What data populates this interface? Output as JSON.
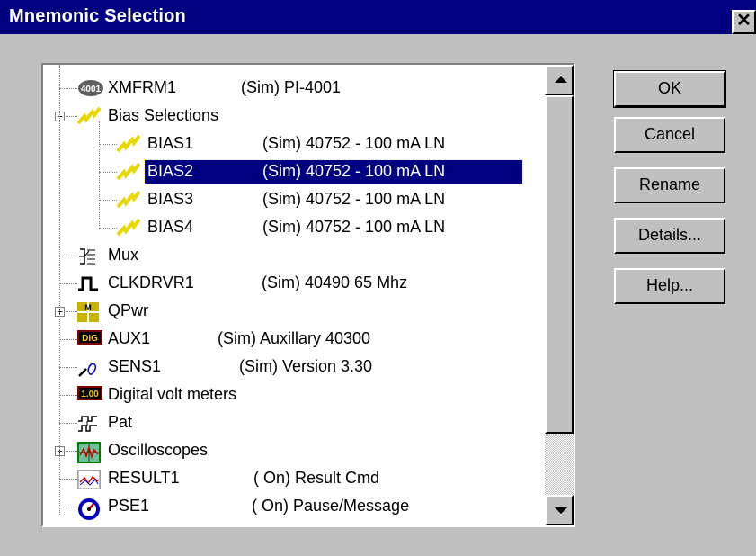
{
  "window": {
    "title": "Mnemonic Selection",
    "close_glyph": "✕"
  },
  "tree": {
    "items": [
      {
        "name": "XMFRM1",
        "desc": "(Sim) PI-4001",
        "icon": "chip-4001-icon",
        "icon_text": "4001",
        "level": 0
      },
      {
        "name": "Bias Selections",
        "desc": "",
        "icon": "lightning-icon",
        "level": 0,
        "expander": "−"
      },
      {
        "name": "BIAS1",
        "desc": "(Sim) 40752 - 100 mA LN",
        "icon": "lightning-icon",
        "level": 1
      },
      {
        "name": "BIAS2",
        "desc": "(Sim) 40752 - 100 mA LN",
        "icon": "lightning-icon",
        "level": 1,
        "selected": true
      },
      {
        "name": "BIAS3",
        "desc": "(Sim) 40752 - 100 mA LN",
        "icon": "lightning-icon",
        "level": 1
      },
      {
        "name": "BIAS4",
        "desc": "(Sim) 40752 - 100 mA LN",
        "icon": "lightning-icon",
        "level": 1
      },
      {
        "name": "Mux",
        "desc": "",
        "icon": "mux-icon",
        "level": 0
      },
      {
        "name": "CLKDRVR1",
        "desc": "(Sim) 40490 65 Mhz",
        "icon": "clock-pulse-icon",
        "level": 0
      },
      {
        "name": "QPwr",
        "desc": "",
        "icon": "qpwr-icon",
        "level": 0,
        "expander": "+"
      },
      {
        "name": "AUX1",
        "desc": "(Sim) Auxillary 40300",
        "icon": "dig-icon",
        "icon_text": "DIG",
        "level": 0
      },
      {
        "name": "SENS1",
        "desc": "(Sim) Version 3.30",
        "icon": "sensor-curve-icon",
        "level": 0
      },
      {
        "name": "Digital volt meters",
        "desc": "",
        "icon": "voltmeter-icon",
        "icon_text": "1.00",
        "level": 0
      },
      {
        "name": "Pat",
        "desc": "",
        "icon": "pattern-icon",
        "level": 0
      },
      {
        "name": "Oscilloscopes",
        "desc": "",
        "icon": "oscilloscope-icon",
        "level": 0,
        "expander": "+"
      },
      {
        "name": "RESULT1",
        "desc": "( On) Result Cmd",
        "icon": "result-chart-icon",
        "level": 0
      },
      {
        "name": "PSE1",
        "desc": "( On) Pause/Message",
        "icon": "pause-gauge-icon",
        "level": 0
      }
    ]
  },
  "buttons": {
    "ok": "OK",
    "cancel": "Cancel",
    "rename": "Rename",
    "details": "Details...",
    "help": "Help..."
  }
}
